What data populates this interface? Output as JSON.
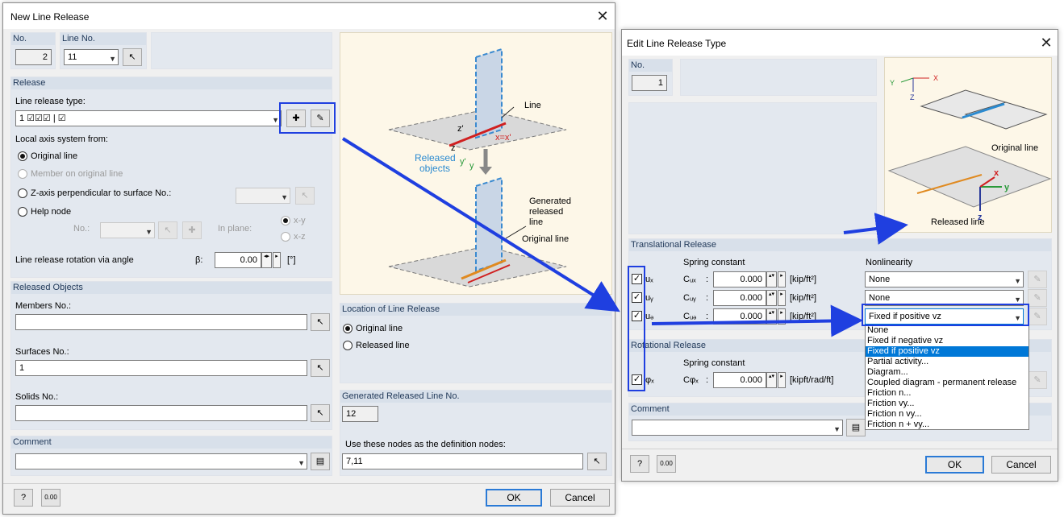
{
  "left": {
    "title": "New Line Release",
    "no_label": "No.",
    "no_value": "2",
    "line_no_label": "Line No.",
    "line_no_value": "11",
    "release_header": "Release",
    "line_release_type_label": "Line release type:",
    "line_release_type_value": "1  ☑☑☑ | ☑",
    "local_axis_label": "Local axis system from:",
    "axis_options": [
      "Original line",
      "Member on original line",
      "Z-axis perpendicular to surface No.:",
      "Help node"
    ],
    "help_no_label": "No.:",
    "in_plane_label": "In plane:",
    "plane_xy": "x-y",
    "plane_xz": "x-z",
    "rotation_label": "Line release rotation via angle",
    "beta_label": "β:",
    "beta_value": "0.00",
    "beta_unit": "[°]",
    "released_objects_header": "Released Objects",
    "members_label": "Members No.:",
    "members_value": "",
    "surfaces_label": "Surfaces No.:",
    "surfaces_value": "1",
    "solids_label": "Solids No.:",
    "solids_value": "",
    "comment_header": "Comment",
    "comment_value": "",
    "location_header": "Location of Line Release",
    "loc_options": [
      "Original line",
      "Released line"
    ],
    "generated_header": "Generated Released Line No.",
    "generated_value": "12",
    "use_nodes_label": "Use these nodes as the definition nodes:",
    "use_nodes_value": "7,11",
    "ok": "OK",
    "cancel": "Cancel",
    "illus": {
      "line": "Line",
      "released1": "Released",
      "released2": "objects",
      "xeq": "x=x'",
      "gen1": "Generated",
      "gen2": "released",
      "gen3": "line",
      "orig": "Original line",
      "z": "z",
      "zp": "z'",
      "y": "y",
      "yp": "y'"
    }
  },
  "right": {
    "title": "Edit Line Release Type",
    "no_label": "No.",
    "no_value": "1",
    "trans_header": "Translational Release",
    "spring_label": "Spring constant",
    "nonlin_label": "Nonlinearity",
    "rows": [
      {
        "dof": "uₓ",
        "c": "Cᵤₓ",
        "value": "0.000",
        "unit": "[kip/ft²]",
        "nonlin": "None"
      },
      {
        "dof": "uᵧ",
        "c": "Cᵤᵧ",
        "value": "0.000",
        "unit": "[kip/ft²]",
        "nonlin": "None"
      },
      {
        "dof": "uₔ",
        "c": "Cᵤₔ",
        "value": "0.000",
        "unit": "[kip/ft²]",
        "nonlin": "Fixed if positive vz"
      }
    ],
    "rot_header": "Rotational Release",
    "rot_spring_label": "Spring constant",
    "rot_dof": "φₓ",
    "rot_c": "Cφₓ",
    "rot_value": "0.000",
    "rot_unit": "[kipft/rad/ft]",
    "comment_header": "Comment",
    "dropdown_options": [
      "None",
      "Fixed if negative vz",
      "Fixed if positive vz",
      "Partial activity...",
      "Diagram...",
      "Coupled diagram - permanent release",
      "Friction n...",
      "Friction vy...",
      "Friction n vy...",
      "Friction n + vy..."
    ],
    "dropdown_selected": 2,
    "ok": "OK",
    "cancel": "Cancel",
    "illus": {
      "orig": "Original line",
      "released": "Released line",
      "y": "y",
      "x": "x",
      "z": "z",
      "Y": "Y",
      "X": "X",
      "Z": "Z"
    }
  },
  "colors": {
    "highlight": "#1f3fe0",
    "arrow": "#1f3fe0",
    "section": "#e3e8ef",
    "selection": "#0078d7"
  }
}
